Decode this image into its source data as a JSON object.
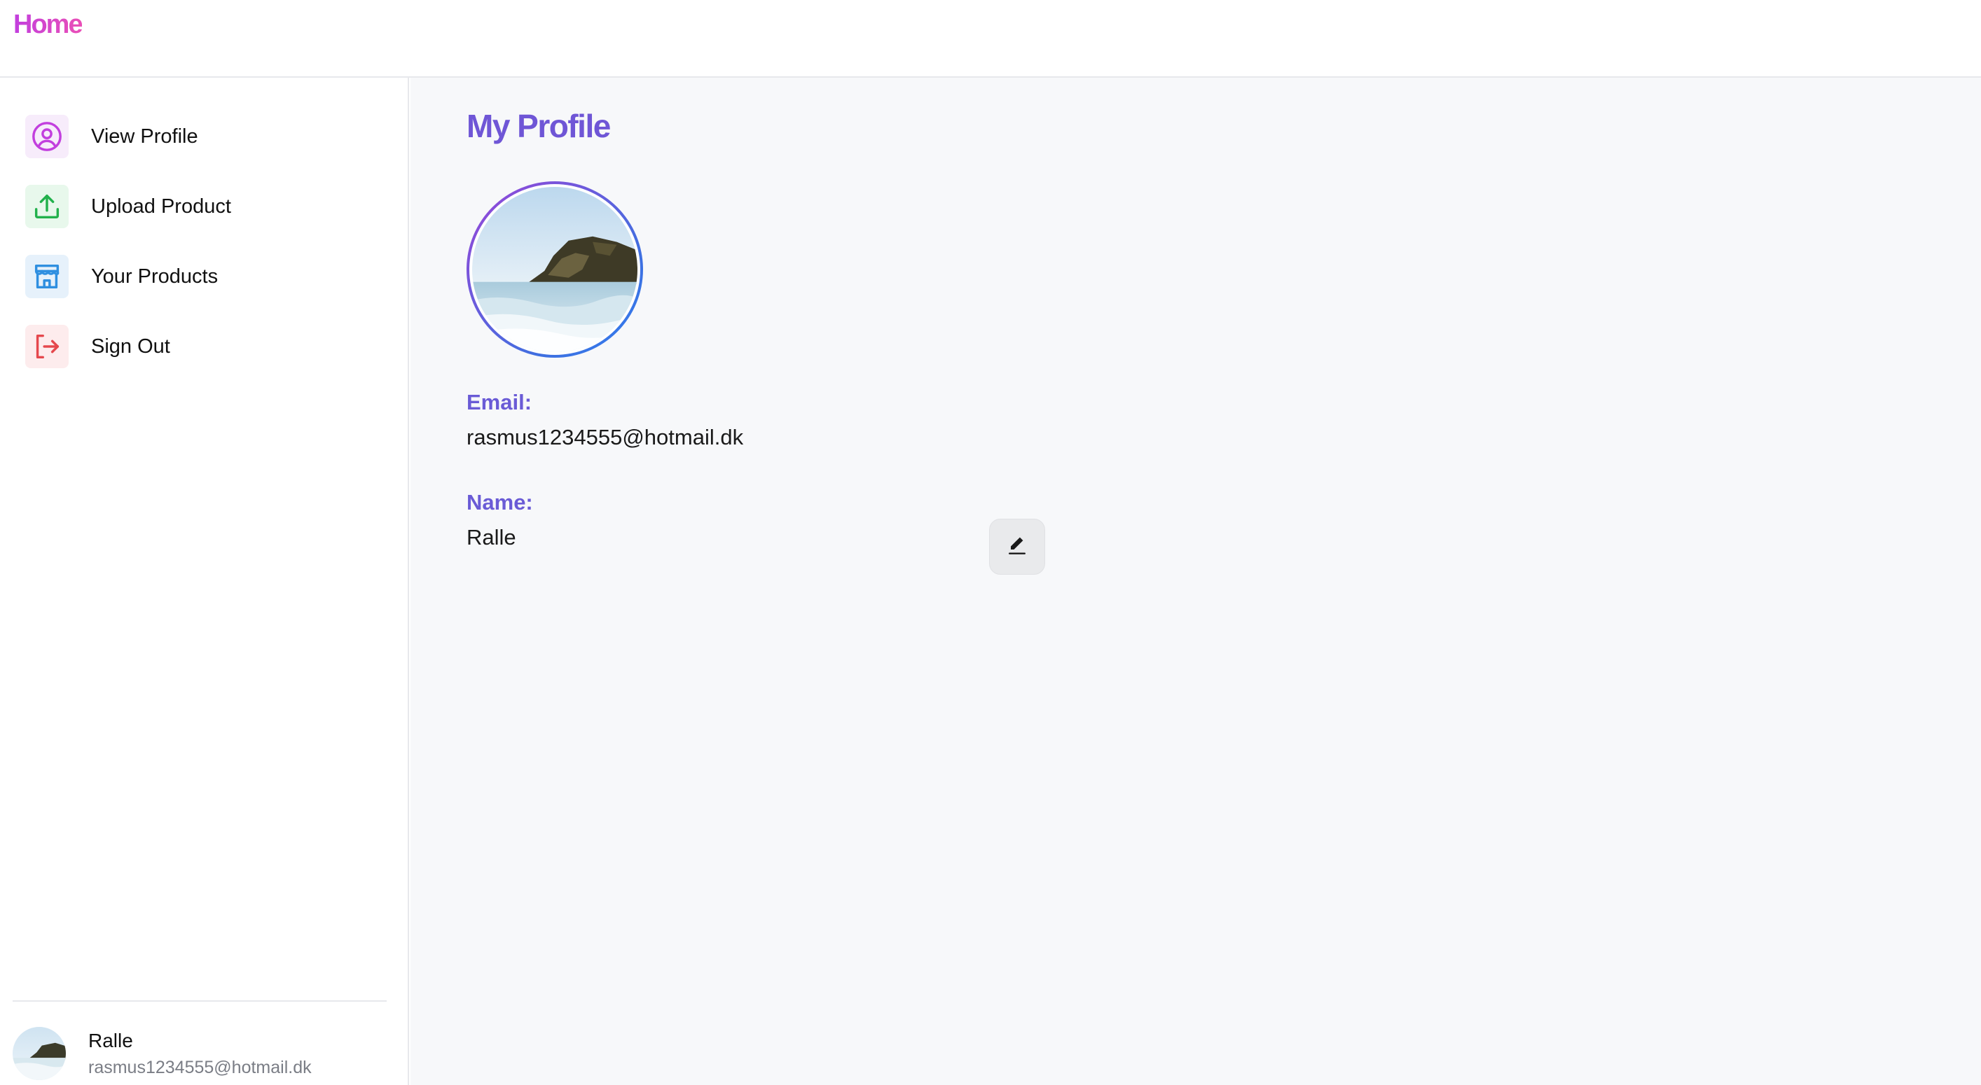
{
  "header": {
    "home_label": "Home"
  },
  "sidebar": {
    "items": [
      {
        "label": "View Profile",
        "icon": "user-circle-icon",
        "color": "#c23fde",
        "bg": "#f7ecfb"
      },
      {
        "label": "Upload Product",
        "icon": "upload-icon",
        "color": "#22b14c",
        "bg": "#e8f8ec"
      },
      {
        "label": "Your Products",
        "icon": "storefront-icon",
        "color": "#2f8fe0",
        "bg": "#e6f1fb"
      },
      {
        "label": "Sign Out",
        "icon": "sign-out-icon",
        "color": "#e5484d",
        "bg": "#fdeced"
      }
    ],
    "user": {
      "name": "Ralle",
      "email": "rasmus1234555@hotmail.dk"
    }
  },
  "main": {
    "title": "My Profile",
    "email_label": "Email:",
    "email_value": "rasmus1234555@hotmail.dk",
    "name_label": "Name:",
    "name_value": "Ralle",
    "edit_icon": "pencil-icon"
  },
  "colors": {
    "accent_purple": "#6f56d6",
    "home_gradient_start": "#c23fde",
    "home_gradient_end": "#ea4fb7"
  }
}
